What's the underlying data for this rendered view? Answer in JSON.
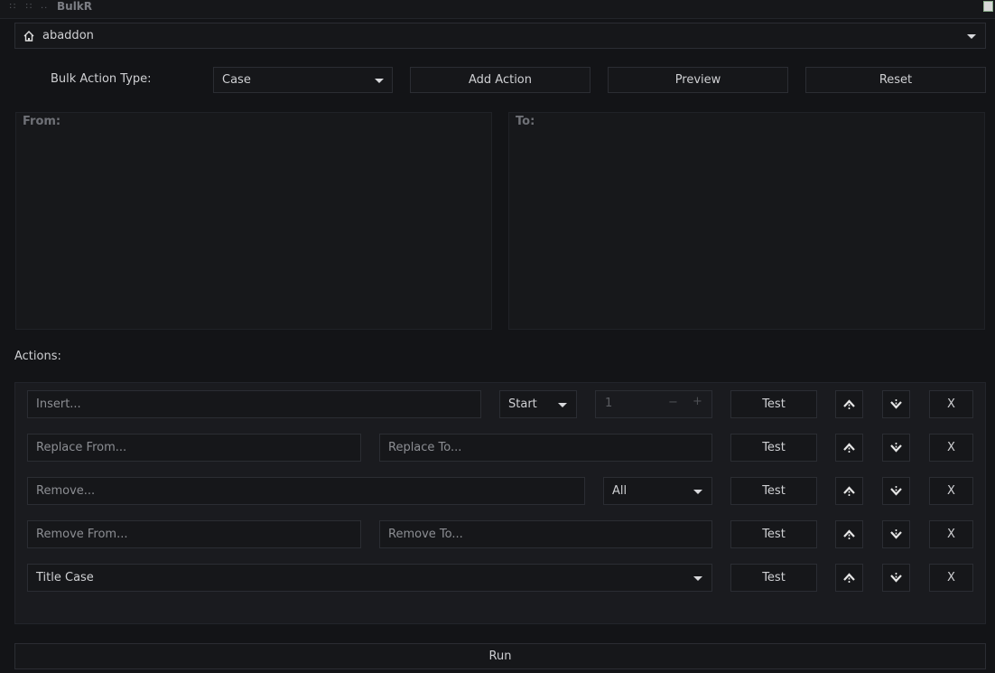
{
  "window": {
    "title": "BulkR",
    "grip_left": "::",
    "grip_mid": "::",
    "grip_dots": ".."
  },
  "location": {
    "path": "abaddon",
    "icon": "home-icon"
  },
  "toolbar": {
    "type_label": "Bulk Action Type:",
    "type_value": "Case",
    "add_action": "Add Action",
    "preview": "Preview",
    "reset": "Reset"
  },
  "from_pane": {
    "title": "From:"
  },
  "to_pane": {
    "title": "To:"
  },
  "actions": {
    "title": "Actions:",
    "rows": [
      {
        "input_placeholder": "Insert...",
        "position": "Start",
        "index": "1",
        "test": "Test",
        "remove": "X"
      },
      {
        "from_placeholder": "Replace From...",
        "to_placeholder": "Replace To...",
        "test": "Test",
        "remove": "X"
      },
      {
        "input_placeholder": "Remove...",
        "mode": "All",
        "test": "Test",
        "remove": "X"
      },
      {
        "from_placeholder": "Remove From...",
        "to_placeholder": "Remove To...",
        "test": "Test",
        "remove": "X"
      },
      {
        "case_value": "Title Case",
        "test": "Test",
        "remove": "X"
      }
    ],
    "spin_minus": "−",
    "spin_plus": "+"
  },
  "run": {
    "label": "Run"
  },
  "icons": {
    "up": "arrow-up-icon",
    "down": "arrow-down-icon",
    "caret": "chevron-down-icon"
  },
  "colors": {
    "background": "#131417",
    "panel": "#1a1b1f",
    "text": "#cfd0d3",
    "placeholder": "#8c8e93"
  }
}
